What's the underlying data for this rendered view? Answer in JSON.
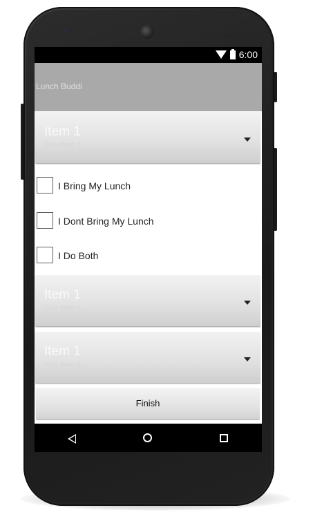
{
  "status_bar": {
    "time": "6:00",
    "wifi_icon": "wifi-icon",
    "battery_icon": "battery-icon"
  },
  "action_bar": {
    "title": "Lunch Buddi"
  },
  "spinners": [
    {
      "main": "Item 1",
      "sub": "Sub Item 1"
    },
    {
      "main": "Item 1",
      "sub": "Sub Item 1"
    },
    {
      "main": "Item 1",
      "sub": "Sub Item 1"
    }
  ],
  "checkboxes": [
    {
      "label": "I Bring My Lunch",
      "checked": false
    },
    {
      "label": "I Dont Bring My Lunch",
      "checked": false
    },
    {
      "label": "I Do Both",
      "checked": false
    }
  ],
  "finish_button": {
    "label": "Finish"
  },
  "nav_bar": {
    "back_icon": "back-icon",
    "home_icon": "home-icon",
    "recents_icon": "recents-icon"
  },
  "colors": {
    "action_bar": "#a9a9a9",
    "status_bar": "#000000",
    "nav_bar": "#000000"
  }
}
